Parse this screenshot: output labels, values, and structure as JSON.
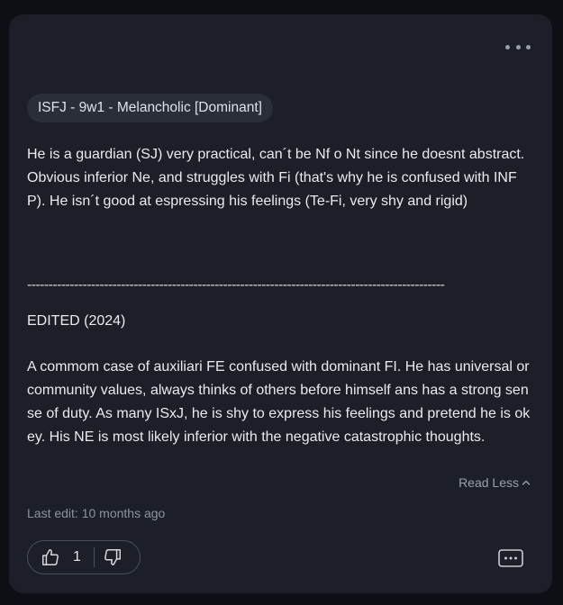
{
  "post": {
    "tag": "ISFJ - 9w1 - Melancholic [Dominant]",
    "paragraph1": "He is a guardian (SJ) very practical, can´t be Nf o Nt since he doesnt abstract. Obvious inferior Ne, and struggles with Fi (that's why he is confused with INFP). He isn´t good at espressing his feelings (Te-Fi, very shy and rigid)",
    "divider": "--------------------------------------------------------------------------------------------------",
    "edited_label": "EDITED (2024)",
    "paragraph2": "A commom case of auxiliari FE confused with dominant FI. He has universal or community values, always thinks of others before himself ans has a strong sense of duty. As many ISxJ, he is shy to express his feelings and pretend he is okey. His NE is most likely inferior with the negative catastrophic thoughts.",
    "read_less_label": "Read Less",
    "last_edit": "Last edit: 10 months ago",
    "upvote_count": "1"
  },
  "icons": {
    "more": "more-horizontal-icon",
    "read_less": "chevron-up-icon",
    "upvote": "thumbs-up-icon",
    "downvote": "thumbs-down-icon",
    "comment": "comment-icon"
  },
  "colors": {
    "background": "#0d0f14",
    "card": "#1c1f27",
    "tag_bg": "#2a2e39",
    "muted_text": "#8d939e"
  }
}
